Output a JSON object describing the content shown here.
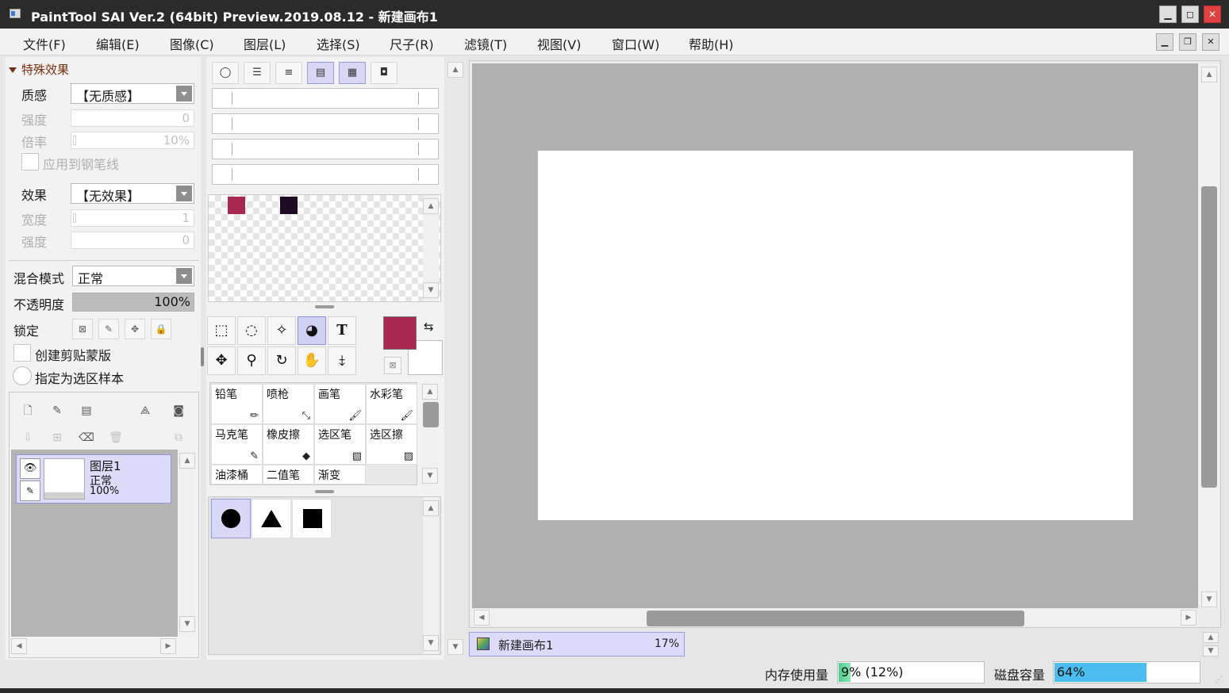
{
  "window": {
    "title": "PaintTool SAI Ver.2 (64bit) Preview.2019.08.12 - 新建画布1",
    "controls": {
      "minimize": "▁",
      "maximize": "◻",
      "close": "✕"
    }
  },
  "menu": [
    "文件(F)",
    "编辑(E)",
    "图像(C)",
    "图层(L)",
    "选择(S)",
    "尺子(R)",
    "滤镜(T)",
    "视图(V)",
    "窗口(W)",
    "帮助(H)"
  ],
  "mdi_controls": {
    "minimize": "▁",
    "restore": "❐",
    "close": "✕"
  },
  "effects": {
    "title": "特殊效果",
    "texture_label": "质感",
    "texture_value": "【无质感】",
    "intensity_label": "强度",
    "intensity_value": "0",
    "scale_label": "倍率",
    "scale_value": "10%",
    "apply_pen_label": "应用到钢笔线",
    "effect_label": "效果",
    "effect_value": "【无效果】",
    "width_label": "宽度",
    "width_value": "1",
    "strength_label": "强度",
    "strength_value": "0"
  },
  "layer_props": {
    "blend_label": "混合模式",
    "blend_value": "正常",
    "opacity_label": "不透明度",
    "opacity_value": "100%",
    "opacity_fraction": 1.0,
    "lock_label": "锁定",
    "clip_label": "创建剪贴蒙版",
    "sample_label": "指定为选区样本"
  },
  "layers": [
    {
      "name": "图层1",
      "mode": "正常",
      "opacity": "100%"
    }
  ],
  "colors": {
    "primary": "#a8294f",
    "swatch_1": "#a8294f",
    "swatch_2": "#1e0a22",
    "accent": "#9c9ce0"
  },
  "brushes": [
    {
      "name": "铅笔",
      "icon": "pencil-icon"
    },
    {
      "name": "喷枪",
      "icon": "airbrush-icon"
    },
    {
      "name": "画笔",
      "icon": "brush-icon"
    },
    {
      "name": "水彩笔",
      "icon": "watercolor-icon"
    },
    {
      "name": "马克笔",
      "icon": "marker-icon"
    },
    {
      "name": "橡皮擦",
      "icon": "eraser-icon"
    },
    {
      "name": "选区笔",
      "icon": "select-pen-icon"
    },
    {
      "name": "选区擦",
      "icon": "select-eraser-icon"
    },
    {
      "name": "油漆桶",
      "icon": "bucket-icon"
    },
    {
      "name": "二值笔",
      "icon": "binary-pen-icon"
    },
    {
      "name": "渐变",
      "icon": "gradient-icon"
    }
  ],
  "tools": {
    "text_tool": "T"
  },
  "document": {
    "name": "新建画布1",
    "zoom": "17%"
  },
  "status": {
    "memory_label": "内存使用量",
    "memory_value": "9% (12%)",
    "memory_fraction": 0.09,
    "disk_label": "磁盘容量",
    "disk_value": "64%",
    "disk_fraction": 0.64
  }
}
